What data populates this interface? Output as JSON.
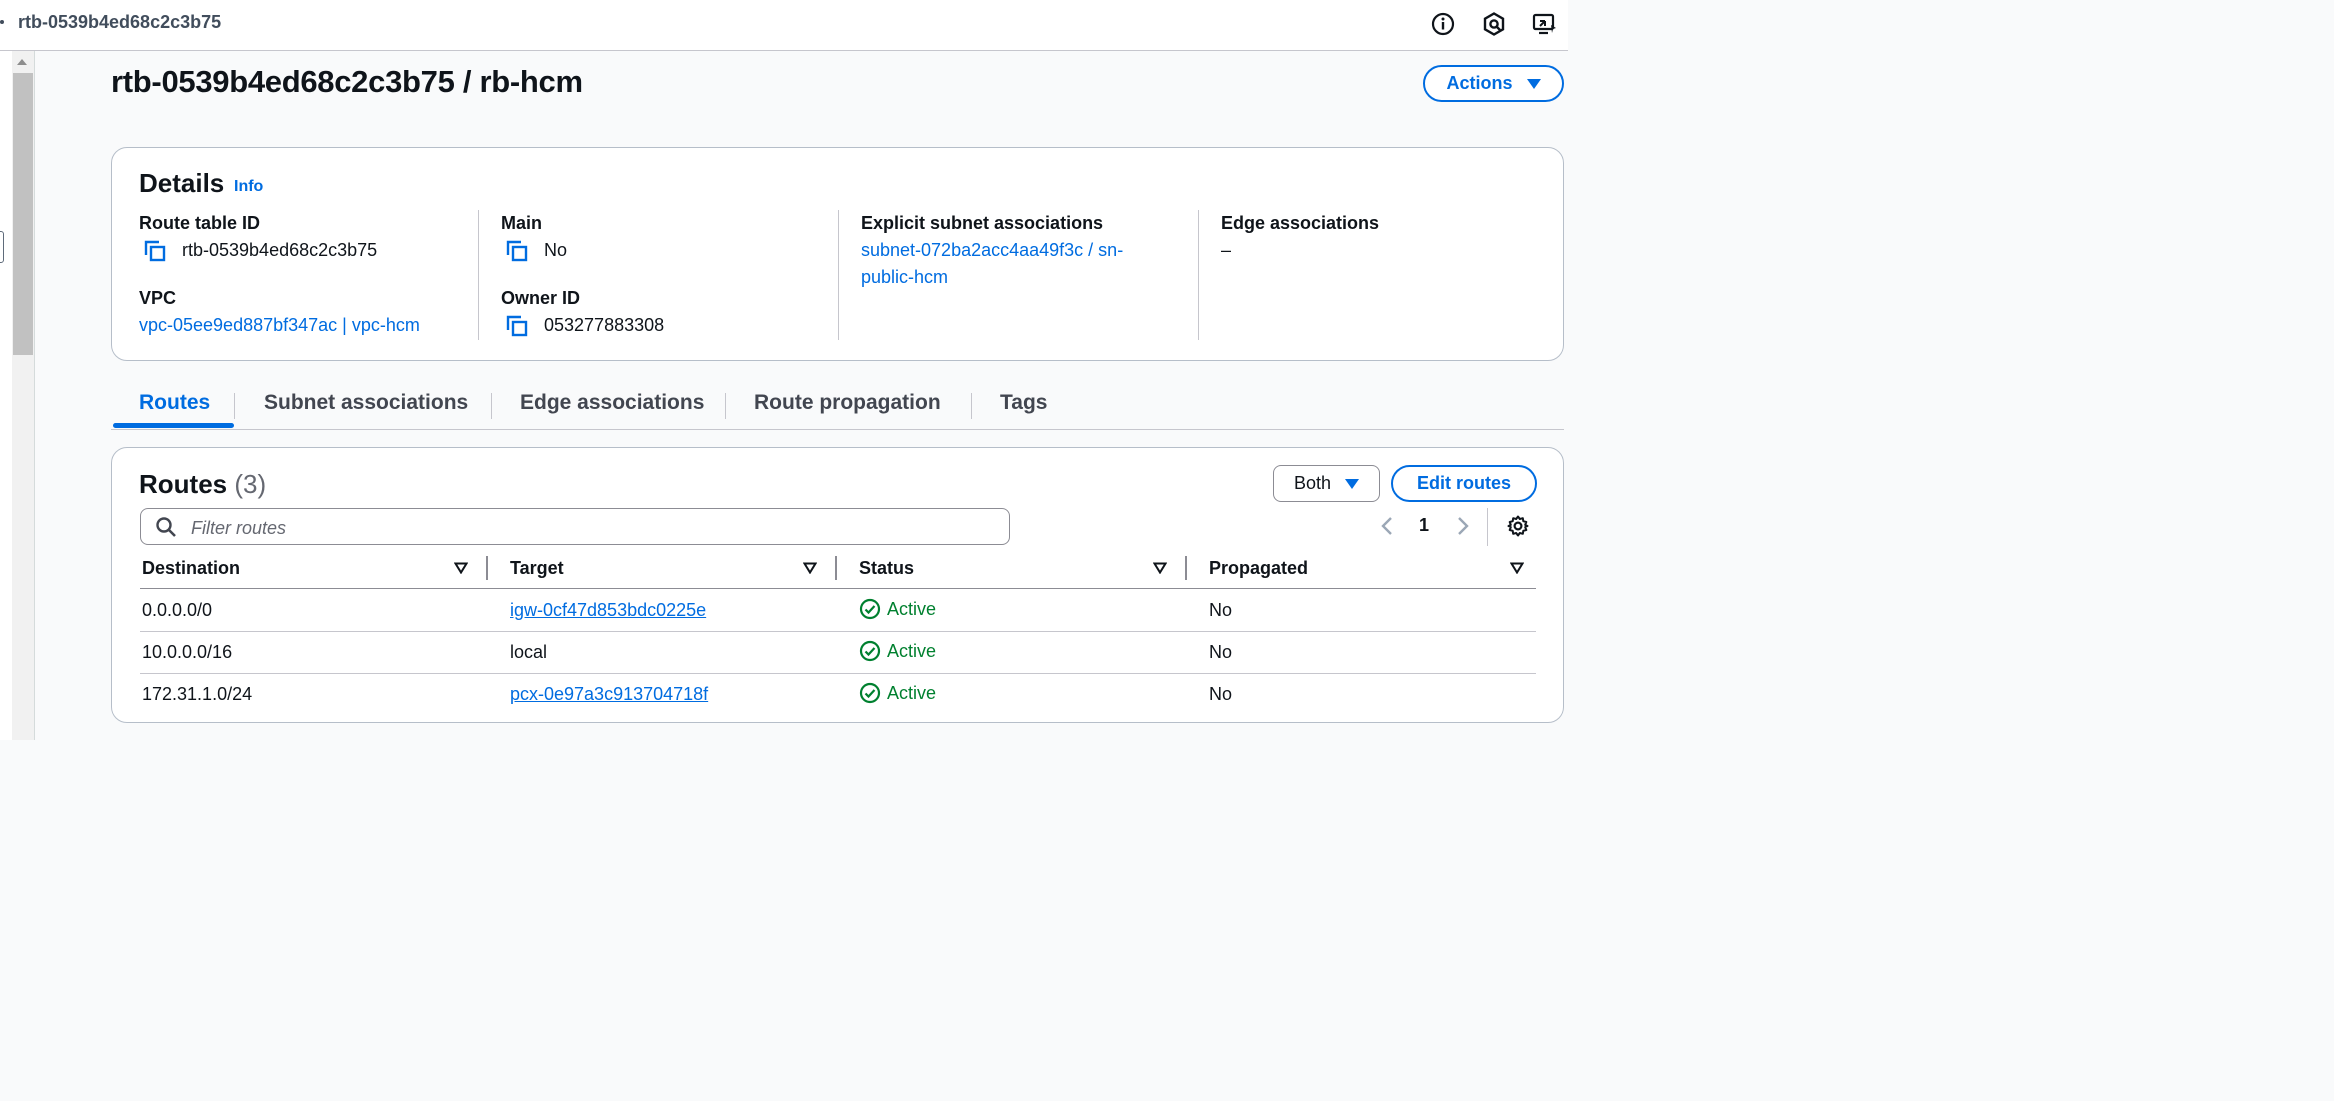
{
  "topbar": {
    "title": "rtb-0539b4ed68c2c3b75",
    "icons": [
      "info-icon",
      "hexagon-icon",
      "screen-share-icon"
    ]
  },
  "page": {
    "title": "rtb-0539b4ed68c2c3b75 / rb-hcm",
    "actions_label": "Actions"
  },
  "details": {
    "heading": "Details",
    "info_label": "Info",
    "route_table_id_label": "Route table ID",
    "route_table_id": "rtb-0539b4ed68c2c3b75",
    "vpc_label": "VPC",
    "vpc_value": "vpc-05ee9ed887bf347ac | vpc-hcm",
    "main_label": "Main",
    "main_value": "No",
    "owner_label": "Owner ID",
    "owner_value": "053277883308",
    "explicit_label": "Explicit subnet associations",
    "explicit_line1": "subnet-072ba2acc4aa49f3c / sn-",
    "explicit_line2": "public-hcm",
    "edge_label": "Edge associations",
    "edge_value": "–"
  },
  "tabs": [
    {
      "label": "Routes",
      "active": true
    },
    {
      "label": "Subnet associations",
      "active": false
    },
    {
      "label": "Edge associations",
      "active": false
    },
    {
      "label": "Route propagation",
      "active": false
    },
    {
      "label": "Tags",
      "active": false
    }
  ],
  "routes": {
    "heading": "Routes",
    "count": "(3)",
    "filter_select": "Both",
    "edit_label": "Edit routes",
    "search_placeholder": "Filter routes",
    "page_number": "1",
    "columns": [
      "Destination",
      "Target",
      "Status",
      "Propagated"
    ],
    "rows": [
      {
        "destination": "0.0.0.0/0",
        "target": "igw-0cf47d853bdc0225e",
        "target_link": true,
        "status": "Active",
        "propagated": "No"
      },
      {
        "destination": "10.0.0.0/16",
        "target": "local",
        "target_link": false,
        "status": "Active",
        "propagated": "No"
      },
      {
        "destination": "172.31.1.0/24",
        "target": "pcx-0e97a3c913704718f",
        "target_link": true,
        "status": "Active",
        "propagated": "No"
      }
    ]
  },
  "colors": {
    "accent": "#006ce0",
    "success": "#00802f",
    "text": "#0f141a",
    "border": "#b6bec9"
  }
}
